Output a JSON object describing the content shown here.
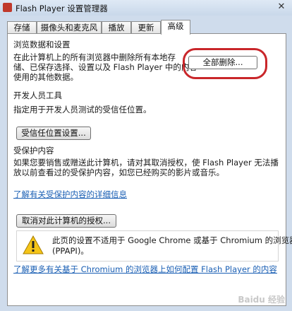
{
  "window": {
    "title": "Flash Player 设置管理器",
    "close_glyph": "✕"
  },
  "tabs": [
    "存储",
    "摄像头和麦克风",
    "播放",
    "更新",
    "高级"
  ],
  "browsing_data": {
    "heading": "浏览数据和设置",
    "desc_line1": "在此计算机上的所有浏览器中删除所有本地存",
    "desc_line2": "储、已保存选择、设置以及 Flash Player 中的内容",
    "desc_line3": "使用的其他数据。",
    "delete_all_button": "全部删除..."
  },
  "developer_tools": {
    "heading": "开发人员工具",
    "desc": "指定用于开发人员测试的受信任位置。",
    "trusted_location_button": "受信任位置设置..."
  },
  "protected_content": {
    "heading": "受保护内容",
    "desc_line1": "如果您要销售或赠送此计算机，请对其取消授权，使 Flash Player 无法播",
    "desc_line2": "放以前查看过的受保护内容，如您已经购买的影片或音乐。",
    "learn_more_link": "了解有关受保护内容的详细信息",
    "deauthorize_button": "取消对此计算机的授权..."
  },
  "warning": {
    "line1": "此页的设置不适用于 Google Chrome 或基于 Chromium 的浏览器",
    "line2": "(PPAPI)。"
  },
  "chromium_link": "了解更多有关基于 Chromium 的浏览器上如何配置 Flash Player 的内容",
  "watermark": "Baidu 经验"
}
